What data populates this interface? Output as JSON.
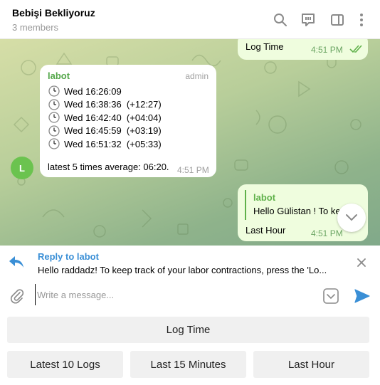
{
  "header": {
    "title": "Bebişi Bekliyoruz",
    "subtitle": "3 members"
  },
  "messages": {
    "top_out": {
      "text": "Log Time",
      "time": "4:51 PM"
    },
    "labot_msg": {
      "sender": "labot",
      "role": "admin",
      "logs": [
        {
          "text": "Wed 16:26:09"
        },
        {
          "text": "Wed 16:38:36  (+12:27)"
        },
        {
          "text": "Wed 16:42:40  (+04:04)"
        },
        {
          "text": "Wed 16:45:59  (+03:19)"
        },
        {
          "text": "Wed 16:51:32  (+05:33)"
        }
      ],
      "average": "latest 5 times average: 06:20.",
      "time": "4:51 PM"
    },
    "avatar_letter": "L",
    "reply_out": {
      "quote_sender": "labot",
      "quote_text": "Hello Gülistan ! To ke",
      "text": "Last Hour",
      "time": "4:51 PM"
    }
  },
  "reply_bar": {
    "title": "Reply to labot",
    "text": "Hello raddadz! To keep track of your labor contractions, press the 'Lo..."
  },
  "composer": {
    "placeholder": "Write a message..."
  },
  "keyboard": {
    "row1": [
      "Log Time"
    ],
    "row2": [
      "Latest 10 Logs",
      "Last 15 Minutes",
      "Last Hour"
    ]
  },
  "colors": {
    "accent": "#3a8fd6",
    "sent_bubble": "#effdde",
    "avatar": "#6bc34f"
  }
}
